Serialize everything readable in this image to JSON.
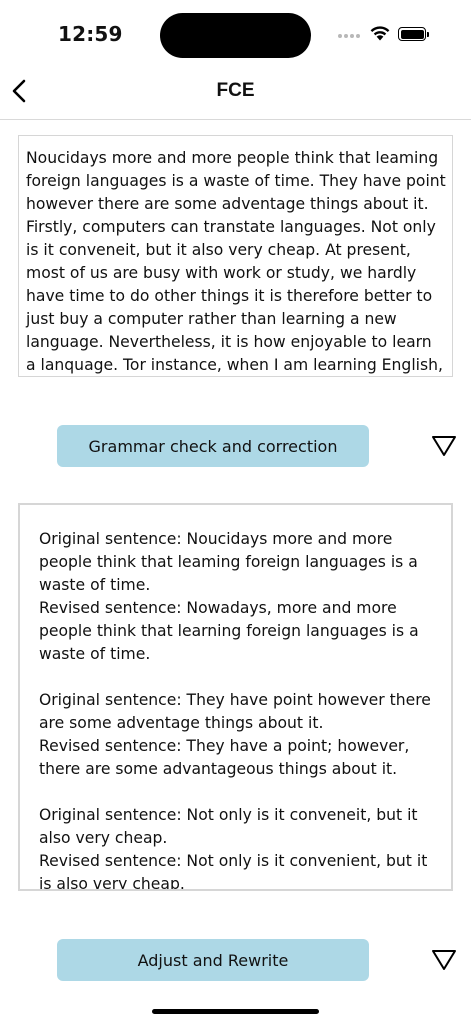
{
  "status_bar": {
    "time": "12:59"
  },
  "nav": {
    "title": "FCE",
    "back_icon": "chevron-left-icon"
  },
  "essay": {
    "text": "Noucidays more and more people think that leaming foreign languages is a waste of time. They have point however there are some adventage things about it. Firstly, computers can transtate languages. Not only is it conveneit, but it also very cheap. At present, most of us are busy with work or study, we hardly have time to do other things it is therefore better to just buy a computer rather than learning a new language. Nevertheless, it is how enjoyable to learn a lanquage. Tor instance, when I am learning English, L feel really"
  },
  "grammar": {
    "button_label": "Grammar check and correction",
    "toggle_icon": "triangle-down-icon",
    "results": [
      {
        "original": "Original sentence: Noucidays more and more people think that leaming foreign languages is a waste of time.",
        "revised": "Revised sentence: Nowadays, more and more people think that learning foreign languages is a waste of time."
      },
      {
        "original": "Original sentence: They have point however there are some adventage things about it.",
        "revised": "Revised sentence: They have a point; however, there are some advantageous things about it."
      },
      {
        "original": "Original sentence: Not only is it conveneit, but it also very cheap.",
        "revised": "Revised sentence: Not only is it convenient, but it is also very cheap."
      }
    ]
  },
  "rewrite": {
    "button_label": "Adjust and Rewrite",
    "toggle_icon": "triangle-down-icon"
  },
  "colors": {
    "button_bg": "#add8e6",
    "border": "#d6d6d6"
  }
}
